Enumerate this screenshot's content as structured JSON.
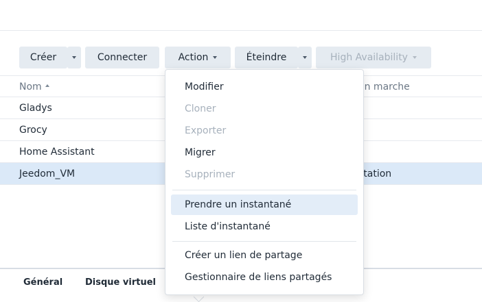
{
  "toolbar": {
    "create_label": "Créer",
    "connect_label": "Connecter",
    "action_label": "Action",
    "shutdown_label": "Éteindre",
    "ha_label": "High Availability"
  },
  "table": {
    "columns": [
      "Nom",
      "en marche"
    ],
    "rows": [
      {
        "name": "Gladys",
        "status": ""
      },
      {
        "name": "Grocy",
        "status": ""
      },
      {
        "name": "Home Assistant",
        "status": ""
      },
      {
        "name": "Jeedom_VM",
        "status": "station"
      }
    ]
  },
  "action_menu": {
    "items": [
      "Modifier",
      "Cloner",
      "Exporter",
      "Migrer",
      "Supprimer",
      "Prendre un instantané",
      "Liste d'instantané",
      "Créer un lien de partage",
      "Gestionnaire de liens partagés"
    ]
  },
  "bottom_tabs": [
    "Général",
    "Disque virtuel"
  ],
  "colors": {
    "button_bg": "#e5ebf1",
    "selected_row": "#dbe9f8",
    "menu_highlight": "#e3edf8",
    "disabled_text": "#a7b1bc"
  },
  "icons": {
    "sort": "sort-ascending-icon",
    "dropdown": "chevron-down-icon"
  }
}
